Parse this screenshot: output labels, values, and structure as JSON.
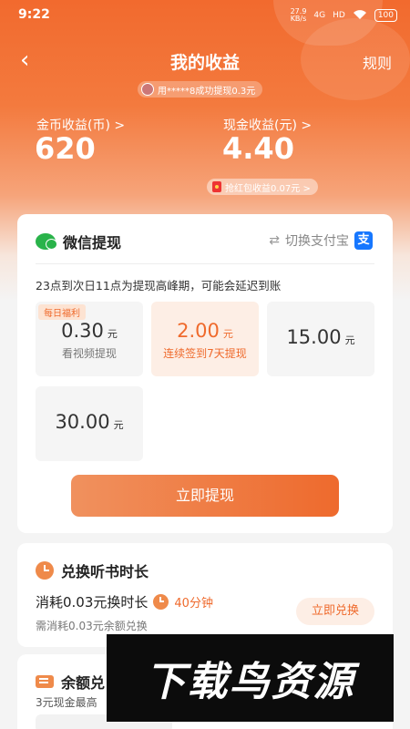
{
  "status_bar": {
    "time": "9:22",
    "net_speed_value": "27.9",
    "net_speed_unit": "KB/s",
    "signal_label": "4G",
    "hd_label": "HD",
    "battery": "100"
  },
  "nav": {
    "back_glyph": "‹",
    "title": "我的收益",
    "rules": "规则"
  },
  "notice": {
    "text": "用*****8成功提现0.3元"
  },
  "earnings": {
    "coin_label": "金币收益(币) >",
    "coin_value": "620",
    "cash_label": "现金收益(元) >",
    "cash_value": "4.40",
    "hongbao_text": "抢红包收益0.07元 >"
  },
  "withdraw": {
    "method": "微信提现",
    "switch_label": "切换支付宝",
    "alipay_glyph": "支",
    "peak_notice": "23点到次日11点为提现高峰期，可能会延迟到账",
    "options": [
      {
        "badge": "每日福利",
        "amount": "0.30",
        "unit": "元",
        "desc": "看视频提现"
      },
      {
        "amount": "2.00",
        "unit": "元",
        "desc": "连续签到7天提现"
      },
      {
        "amount": "15.00",
        "unit": "元"
      },
      {
        "amount": "30.00",
        "unit": "元"
      }
    ],
    "button": "立即提现"
  },
  "exchange": {
    "title": "兑换听书时长",
    "main_text": "消耗0.03元换时长",
    "duration": "40分钟",
    "sub_text": "需消耗0.03元余额兑换",
    "button": "立即兑换"
  },
  "balance": {
    "title": "余额兑",
    "sub_text": "3元现金最高"
  },
  "watermark": {
    "text": "下载鸟资源"
  },
  "colors": {
    "accent": "#ef6a2c",
    "wechat": "#29b34a",
    "alipay": "#1677ff"
  },
  "icons": [
    "back-icon",
    "wechat-icon",
    "switch-icon",
    "alipay-icon",
    "clock-icon",
    "ticket-icon",
    "hongbao-icon"
  ]
}
